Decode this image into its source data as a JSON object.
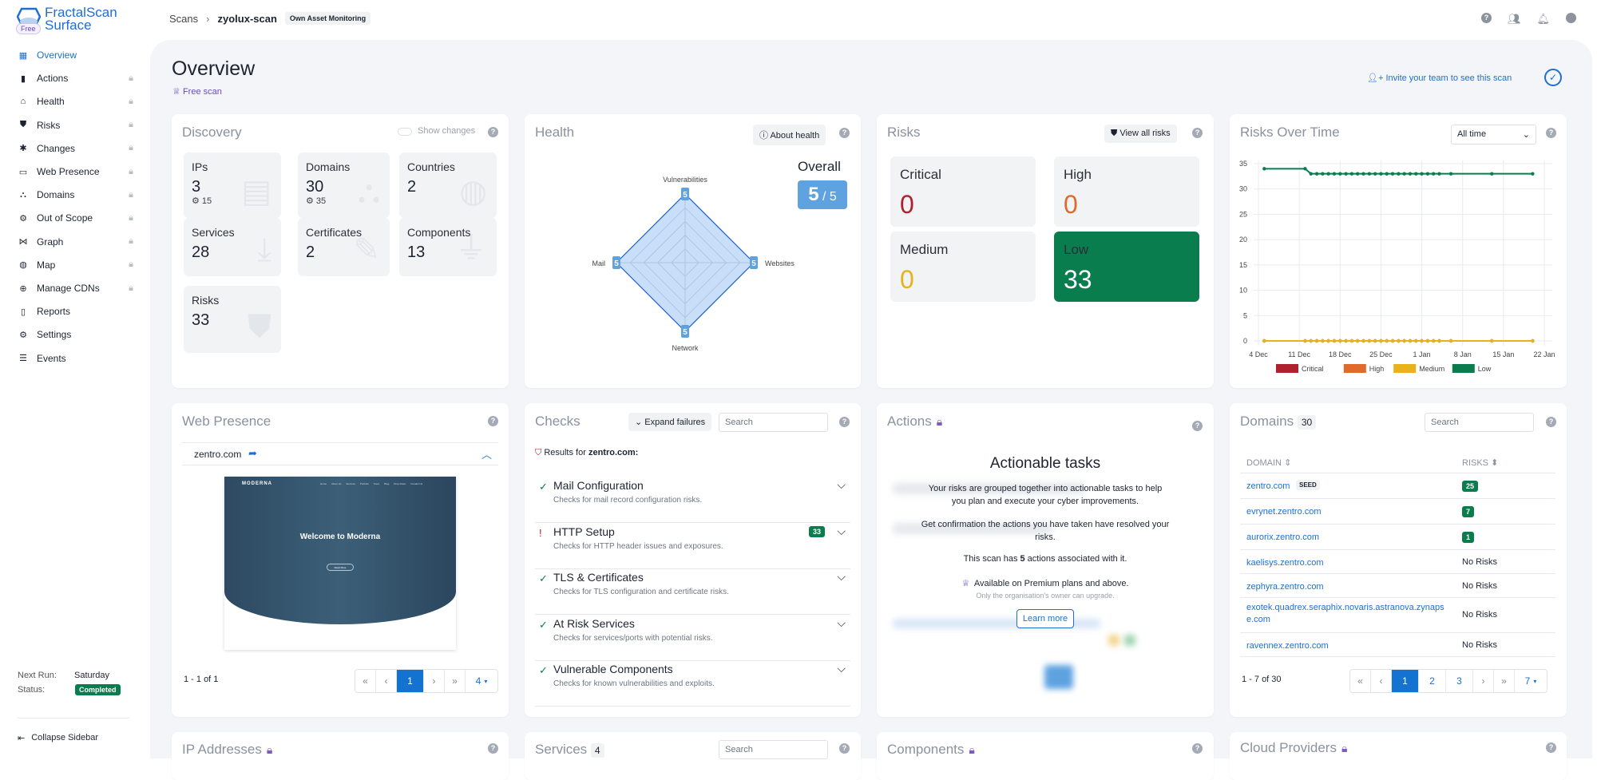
{
  "app": {
    "name_line1": "FractalScan",
    "name_line2": "Surface",
    "plan_badge": "Free"
  },
  "breadcrumb": {
    "root": "Scans",
    "separator": "›",
    "scan": "zyolux-scan",
    "tag": "Own Asset Monitoring"
  },
  "topbar_icons": [
    "help-icon",
    "team-icon",
    "bell-icon",
    "user-icon"
  ],
  "sidebar": {
    "items": [
      {
        "label": "Overview",
        "icon": "grid-icon",
        "active": true,
        "locked": false
      },
      {
        "label": "Actions",
        "icon": "clipboard-icon",
        "locked": true
      },
      {
        "label": "Health",
        "icon": "home-heart-icon",
        "locked": true
      },
      {
        "label": "Risks",
        "icon": "shield-icon",
        "locked": true
      },
      {
        "label": "Changes",
        "icon": "asterisk-icon",
        "locked": true
      },
      {
        "label": "Web Presence",
        "icon": "monitor-icon",
        "locked": true
      },
      {
        "label": "Domains",
        "icon": "sitemap-icon",
        "locked": true
      },
      {
        "label": "Out of Scope",
        "icon": "dashed-gear-icon",
        "locked": true
      },
      {
        "label": "Graph",
        "icon": "graph-icon",
        "locked": true
      },
      {
        "label": "Map",
        "icon": "globe-icon",
        "locked": true
      },
      {
        "label": "Manage CDNs",
        "icon": "network-globe-icon",
        "locked": true
      },
      {
        "label": "Reports",
        "icon": "report-icon",
        "locked": false
      },
      {
        "label": "Settings",
        "icon": "gear-icon",
        "locked": false
      },
      {
        "label": "Events",
        "icon": "server-icon",
        "locked": false
      }
    ],
    "next_run_label": "Next Run:",
    "next_run_value": "Saturday",
    "status_label": "Status:",
    "status_value": "Completed",
    "collapse_label": "Collapse Sidebar"
  },
  "page": {
    "title": "Overview",
    "plan": "Free scan",
    "invite": "Invite your team to see this scan"
  },
  "discovery": {
    "title": "Discovery",
    "show_changes": "Show changes",
    "tiles": [
      {
        "label": "IPs",
        "value": "3",
        "sub": "15"
      },
      {
        "label": "Domains",
        "value": "30",
        "sub": "35"
      },
      {
        "label": "Countries",
        "value": "2"
      },
      {
        "label": "Services",
        "value": "28"
      },
      {
        "label": "Certificates",
        "value": "2"
      },
      {
        "label": "Components",
        "value": "13"
      },
      {
        "label": "Risks",
        "value": "33"
      }
    ]
  },
  "health": {
    "title": "Health",
    "about": "About health",
    "overall_label": "Overall",
    "overall_score": "5",
    "overall_max": "5",
    "axes": [
      {
        "label": "Vulnerabilities",
        "score": 5
      },
      {
        "label": "Websites",
        "score": 5
      },
      {
        "label": "Network",
        "score": 5
      },
      {
        "label": "Mail",
        "score": 5
      }
    ],
    "max": 5
  },
  "risks": {
    "title": "Risks",
    "view_all": "View all risks",
    "tiles": [
      {
        "label": "Critical",
        "value": "0",
        "color": "#b0212f"
      },
      {
        "label": "High",
        "value": "0",
        "color": "#e06a2b"
      },
      {
        "label": "Medium",
        "value": "0",
        "color": "#e8b21c"
      },
      {
        "label": "Low",
        "value": "33",
        "color": "#0a7d4f"
      }
    ]
  },
  "risks_over_time": {
    "title": "Risks Over Time",
    "range": "All time",
    "chart_data": {
      "type": "line",
      "x_ticks": [
        "4 Dec",
        "11 Dec",
        "18 Dec",
        "25 Dec",
        "1 Jan",
        "8 Jan",
        "15 Jan",
        "22 Jan"
      ],
      "y_ticks": [
        0,
        5,
        10,
        15,
        20,
        25,
        30,
        35
      ],
      "ylim": [
        0,
        35
      ],
      "grid": true,
      "legend_position": "bottom",
      "x": [
        "5 Dec",
        "12 Dec",
        "13 Dec",
        "14 Dec",
        "15 Dec",
        "16 Dec",
        "17 Dec",
        "18 Dec",
        "19 Dec",
        "20 Dec",
        "21 Dec",
        "22 Dec",
        "23 Dec",
        "24 Dec",
        "25 Dec",
        "26 Dec",
        "27 Dec",
        "28 Dec",
        "29 Dec",
        "30 Dec",
        "31 Dec",
        "1 Jan",
        "2 Jan",
        "3 Jan",
        "4 Jan",
        "6 Jan",
        "13 Jan",
        "20 Jan"
      ],
      "series": [
        {
          "name": "Critical",
          "color": "#b0212f",
          "values": [
            0,
            0,
            0,
            0,
            0,
            0,
            0,
            0,
            0,
            0,
            0,
            0,
            0,
            0,
            0,
            0,
            0,
            0,
            0,
            0,
            0,
            0,
            0,
            0,
            0,
            0,
            0,
            0
          ]
        },
        {
          "name": "High",
          "color": "#e06a2b",
          "values": [
            0,
            0,
            0,
            0,
            0,
            0,
            0,
            0,
            0,
            0,
            0,
            0,
            0,
            0,
            0,
            0,
            0,
            0,
            0,
            0,
            0,
            0,
            0,
            0,
            0,
            0,
            0,
            0
          ]
        },
        {
          "name": "Medium",
          "color": "#e8b21c",
          "values": [
            0,
            0,
            0,
            0,
            0,
            0,
            0,
            0,
            0,
            0,
            0,
            0,
            0,
            0,
            0,
            0,
            0,
            0,
            0,
            0,
            0,
            0,
            0,
            0,
            0,
            0,
            0,
            0
          ]
        },
        {
          "name": "Low",
          "color": "#0a7d4f",
          "values": [
            34,
            34,
            33,
            33,
            33,
            33,
            33,
            33,
            33,
            33,
            33,
            33,
            33,
            33,
            33,
            33,
            33,
            33,
            33,
            33,
            33,
            33,
            33,
            33,
            33,
            33,
            33,
            33
          ]
        }
      ]
    }
  },
  "web_presence": {
    "title": "Web Presence",
    "domain": "zentro.com",
    "shot": {
      "brand": "MODERNA",
      "heading": "Welcome to Moderna",
      "nav": [
        "Home",
        "About Us",
        "Services",
        "Portfolio",
        "Team",
        "Blog",
        "Drop Down",
        "Contact Us"
      ],
      "button": "Read More"
    },
    "range": "1 - 1 of 1",
    "pages": [
      "«",
      "‹",
      "1",
      "›",
      "»"
    ],
    "per_page": "4"
  },
  "checks": {
    "title": "Checks",
    "expand": "Expand failures",
    "search_placeholder": "Search",
    "results_prefix": "Results for ",
    "results_domain": "zentro.com:",
    "items": [
      {
        "title": "Mail Configuration",
        "desc": "Checks for mail record configuration risks.",
        "status": "pass"
      },
      {
        "title": "HTTP Setup",
        "desc": "Checks for HTTP header issues and exposures.",
        "status": "fail",
        "count": "33"
      },
      {
        "title": "TLS & Certificates",
        "desc": "Checks for TLS configuration and certificate risks.",
        "status": "pass"
      },
      {
        "title": "At Risk Services",
        "desc": "Checks for services/ports with potential risks.",
        "status": "pass"
      },
      {
        "title": "Vulnerable Components",
        "desc": "Checks for known vulnerabilities and exploits.",
        "status": "pass"
      }
    ]
  },
  "actions": {
    "title": "Actions",
    "heading": "Actionable tasks",
    "p1": "Your risks are grouped together into actionable tasks to help you plan and execute your cyber improvements.",
    "p2": "Get confirmation the actions you have taken have resolved your risks.",
    "p3_pre": "This scan has ",
    "p3_count": "5",
    "p3_post": " actions associated with it.",
    "premium": "Available on Premium plans and above.",
    "owner_note": "Only the organisation's owner can upgrade.",
    "learn_more": "Learn more"
  },
  "domains": {
    "title": "Domains",
    "count": "30",
    "search_placeholder": "Search",
    "col_domain": "DOMAIN",
    "col_risks": "RISKS",
    "rows": [
      {
        "domain": "zentro.com",
        "seed": "SEED",
        "risks": "25"
      },
      {
        "domain": "evrynet.zentro.com",
        "risks": "7"
      },
      {
        "domain": "aurorix.zentro.com",
        "risks": "1"
      },
      {
        "domain": "kaelisys.zentro.com",
        "risks_text": "No Risks"
      },
      {
        "domain": "zephyra.zentro.com",
        "risks_text": "No Risks"
      },
      {
        "domain": "exotek.quadrex.seraphix.novaris.astranova.zynapse.com",
        "risks_text": "No Risks"
      },
      {
        "domain": "ravennex.zentro.com",
        "risks_text": "No Risks"
      }
    ],
    "range": "1 - 7 of 30",
    "pages": [
      "«",
      "‹",
      "1",
      "2",
      "3",
      "›",
      "»"
    ],
    "per_page": "7"
  },
  "bottom_cards": {
    "ip_addresses": "IP Addresses",
    "services": "Services",
    "services_count": "4",
    "services_search": "Search",
    "components": "Components",
    "cloud_providers": "Cloud Providers"
  }
}
